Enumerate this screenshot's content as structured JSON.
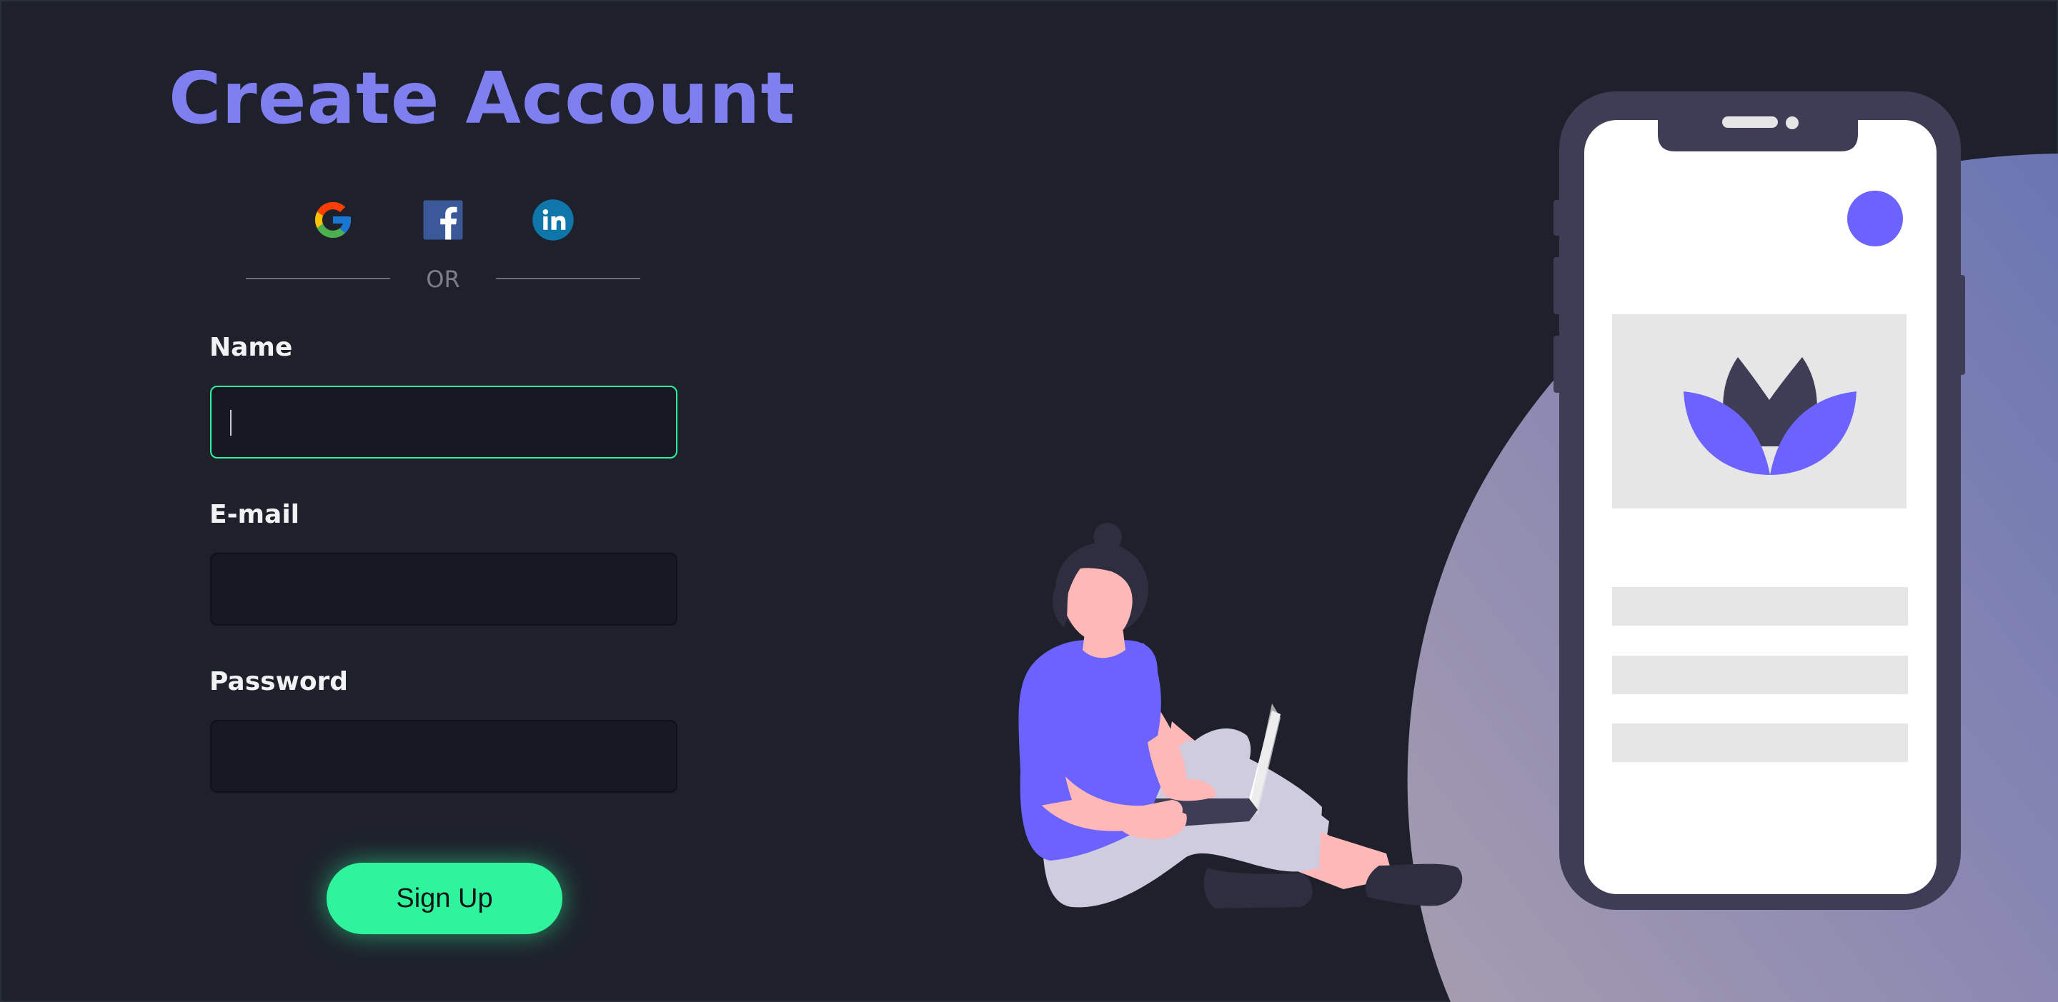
{
  "form": {
    "title": "Create Account",
    "social": [
      {
        "name": "google",
        "icon": "google-icon"
      },
      {
        "name": "facebook",
        "icon": "facebook-icon"
      },
      {
        "name": "linkedin",
        "icon": "linkedin-icon"
      }
    ],
    "divider_text": "OR",
    "fields": {
      "name": {
        "label": "Name",
        "value": "",
        "placeholder": ""
      },
      "email": {
        "label": "E-mail",
        "value": "",
        "placeholder": ""
      },
      "password": {
        "label": "Password",
        "value": "",
        "placeholder": ""
      }
    },
    "submit_label": "Sign Up"
  },
  "colors": {
    "background": "#1e212b",
    "title": "#7f7ff0",
    "accent": "#2ef59c",
    "input_bg": "#161923",
    "illustration_purple": "#6c63ff",
    "phone_frame": "#3f3d56"
  },
  "illustration": {
    "description_icons": [
      "woman-with-laptop",
      "smartphone-mockup",
      "lotus-logo-icon"
    ]
  }
}
